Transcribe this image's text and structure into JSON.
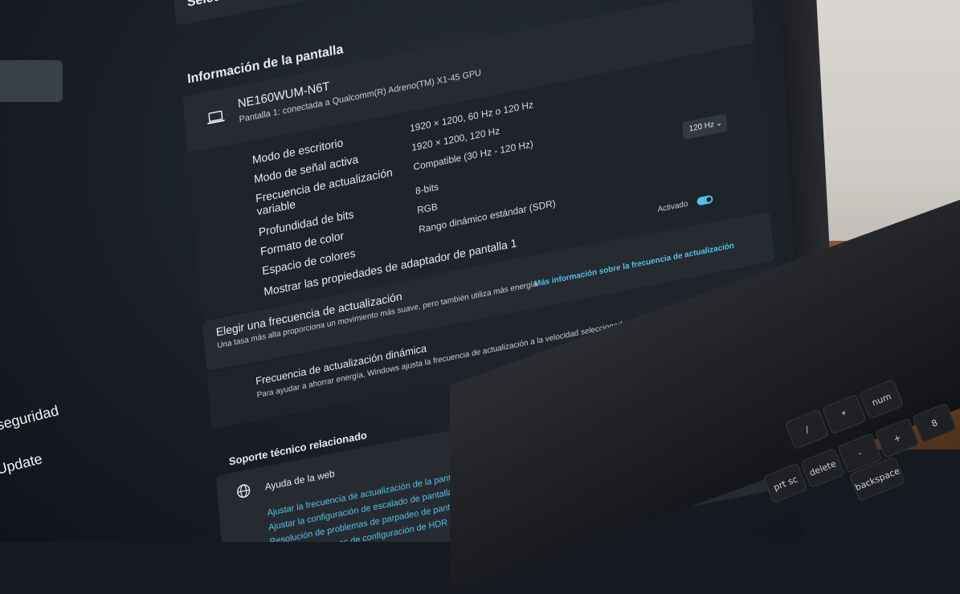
{
  "screen": {
    "top_banner": "Seleccione una pantalla para",
    "section_title": "Información de la pantalla",
    "monitor": {
      "name": "NE160WUM-N6T",
      "subtitle": "Pantalla 1: conectada a Qualcomm(R) Adreno(TM) X1-45 GPU",
      "icon": "laptop-icon"
    },
    "specs": [
      {
        "label": "Modo de escritorio",
        "value": "1920 × 1200, 60 Hz o 120 Hz"
      },
      {
        "label": "Modo de señal activa",
        "value": "1920 × 1200, 120 Hz"
      },
      {
        "label": "Frecuencia de actualización variable",
        "value": "Compatible (30 Hz - 120 Hz)"
      },
      {
        "label": "Profundidad de bits",
        "value": "8-bits"
      },
      {
        "label": "Formato de color",
        "value": "RGB"
      },
      {
        "label": "Espacio de colores",
        "value": "Rango dinámico estándar (SDR)"
      }
    ],
    "adapter_link": "Mostrar las propiedades de adaptador de pantalla 1",
    "refresh": {
      "title": "Elegir una frecuencia de actualización",
      "description": "Una tasa más alta proporciona un movimiento más suave, pero también utiliza más energía",
      "link": "Más información sobre la frecuencia de actualización",
      "selected": "120 Hz"
    },
    "dynamic": {
      "title": "Frecuencia de actualización dinámica",
      "description": "Para ayudar a ahorrar energía, Windows ajusta la frecuencia de actualización a la velocidad seleccionada arriba",
      "toggle_label": "Activado",
      "toggle_on": true
    },
    "support": {
      "title": "Soporte técnico relacionado",
      "web_help": "Ayuda de la web",
      "web_icon": "globe-icon",
      "links": [
        "Ajustar la frecuencia de actualización de la pantalla",
        "Ajustar la configuración de escalado de pantalla",
        "Resolución de problemas de parpadeo de pantalla",
        "Resolver problemas de configuración de HDR"
      ]
    },
    "sidebar": {
      "items": [
        "seguridad",
        "Update"
      ]
    }
  },
  "keyboard": {
    "keys": [
      "num",
      "delete",
      "prt sc",
      "backspace",
      "8",
      "+",
      "-",
      "*",
      "/"
    ]
  },
  "colors": {
    "accent": "#4cc2ea",
    "link": "#56c0e8",
    "background": "#1a1f26",
    "card": "#262b32"
  }
}
